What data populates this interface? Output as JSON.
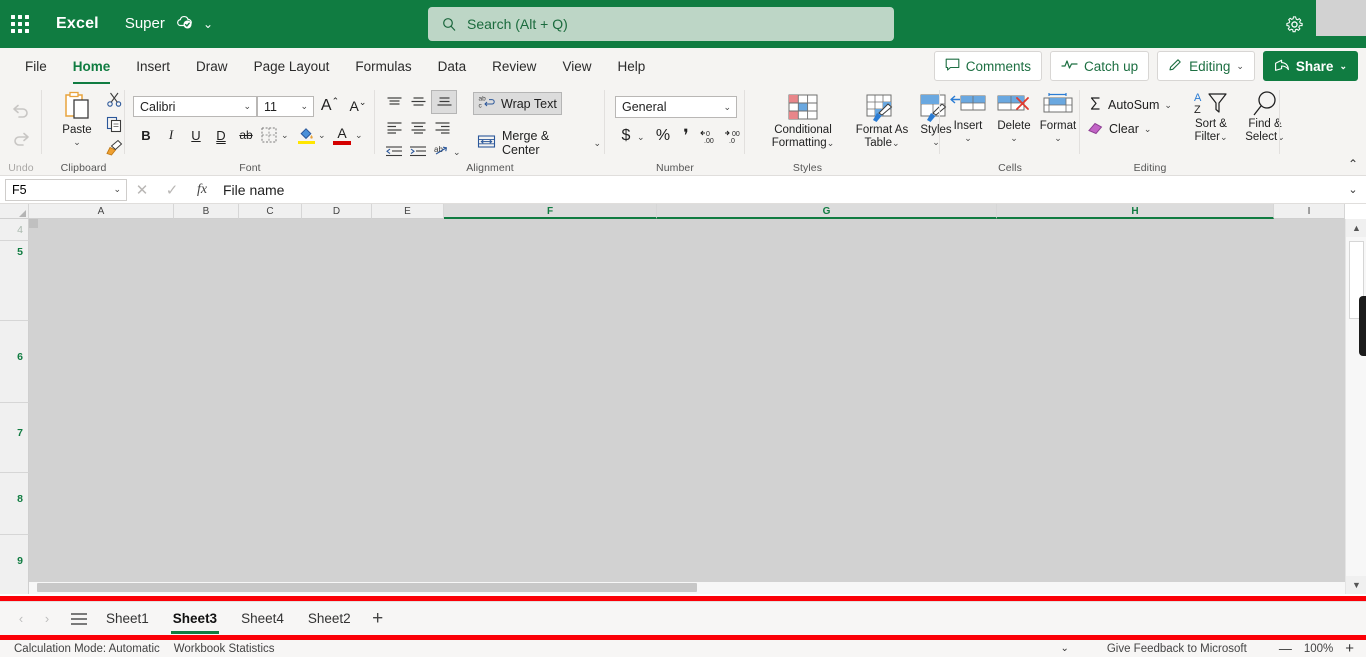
{
  "titlebar": {
    "app_launcher": "app-launcher",
    "brand": "Excel",
    "document_name": "Super",
    "autosave_status_icon": "cloud-check-icon",
    "doc_chevron": "⌄",
    "settings_icon": "gear-icon"
  },
  "search": {
    "placeholder": "Search (Alt + Q)",
    "value": "",
    "icon": "search-icon"
  },
  "ribbon_tabs": [
    {
      "label": "File",
      "active": false
    },
    {
      "label": "Home",
      "active": true
    },
    {
      "label": "Insert",
      "active": false
    },
    {
      "label": "Draw",
      "active": false
    },
    {
      "label": "Page Layout",
      "active": false
    },
    {
      "label": "Formulas",
      "active": false
    },
    {
      "label": "Data",
      "active": false
    },
    {
      "label": "Review",
      "active": false
    },
    {
      "label": "View",
      "active": false
    },
    {
      "label": "Help",
      "active": false
    }
  ],
  "top_actions": {
    "comments": "Comments",
    "catch_up": "Catch up",
    "editing": "Editing",
    "editing_chevron": "⌄",
    "share": "Share",
    "share_chevron": "⌄"
  },
  "ribbon": {
    "undo_group": {
      "label": "Undo",
      "undo": "undo-arrow-icon",
      "redo": "redo-arrow-icon"
    },
    "clipboard": {
      "label": "Clipboard",
      "paste": "Paste",
      "paste_chevron": "⌄",
      "cut_icon": "scissors-icon",
      "copy_icon": "copy-icon",
      "format_painter_icon": "format-painter-icon"
    },
    "font": {
      "label": "Font",
      "font_family": "Calibri",
      "font_size": "11",
      "grow_font": "A",
      "shrink_font": "A",
      "bold": "B",
      "italic": "I",
      "underline": "U",
      "double_underline": "D",
      "strikethrough": "ab",
      "borders_chevron": "⌄",
      "fill_color_chevron": "⌄",
      "font_color_chevron": "⌄",
      "font_color_letter": "A"
    },
    "alignment": {
      "label": "Alignment",
      "wrap_text": "Wrap Text",
      "merge_center": "Merge & Center",
      "merge_chevron": "⌄",
      "orientation_chevron": "⌄"
    },
    "number": {
      "label": "Number",
      "format": "General",
      "format_chevron": "⌄",
      "currency": "$",
      "currency_chevron": "⌄",
      "percent": "%",
      "comma": "❜",
      "increase_decimal": "increase-decimal-icon",
      "decrease_decimal": "decrease-decimal-icon"
    },
    "styles": {
      "label": "Styles",
      "conditional_formatting": "Conditional\nFormatting",
      "conditional_formatting_l1": "Conditional",
      "conditional_formatting_l2": "Formatting",
      "cf_chevron": "⌄",
      "format_as_table_l1": "Format As",
      "format_as_table_l2": "Table",
      "fat_chevron": "⌄",
      "styles_btn": "Styles",
      "styles_chevron": "⌄"
    },
    "cells": {
      "label": "Cells",
      "insert": "Insert",
      "insert_chevron": "⌄",
      "delete": "Delete",
      "delete_chevron": "⌄",
      "format": "Format",
      "format_chevron": "⌄"
    },
    "editing": {
      "label": "Editing",
      "autosum": "AutoSum",
      "autosum_chevron": "⌄",
      "clear": "Clear",
      "clear_chevron": "⌄",
      "sort_filter_l1": "Sort &",
      "sort_filter_l2": "Filter",
      "sort_filter_chevron": "⌄",
      "find_select_l1": "Find &",
      "find_select_l2": "Select",
      "find_select_chevron": "⌄"
    },
    "collapse_icon": "⌃"
  },
  "formula_bar": {
    "name_box": "F5",
    "name_box_chevron": "⌄",
    "cancel_icon": "✕",
    "enter_icon": "✓",
    "function_icon": "fx",
    "value": "File name",
    "expand_chevron": "⌄"
  },
  "grid": {
    "columns": [
      {
        "label": "A",
        "selected": false
      },
      {
        "label": "B",
        "selected": false
      },
      {
        "label": "C",
        "selected": false
      },
      {
        "label": "D",
        "selected": false
      },
      {
        "label": "E",
        "selected": false
      },
      {
        "label": "F",
        "selected": true
      },
      {
        "label": "G",
        "selected": true
      },
      {
        "label": "H",
        "selected": true
      },
      {
        "label": "I",
        "selected": false
      }
    ],
    "rows": [
      {
        "label": "4",
        "dim": true
      },
      {
        "label": "5",
        "dim": false
      },
      {
        "label": "6",
        "dim": false
      },
      {
        "label": "7",
        "dim": false
      },
      {
        "label": "8",
        "dim": false
      },
      {
        "label": "9",
        "dim": false
      }
    ],
    "select_all_icon": "select-all-corner-icon",
    "v_scroll_up": "▲",
    "v_scroll_down": "▼"
  },
  "sheet_bar": {
    "prev_icon": "‹",
    "next_icon": "›",
    "all_sheets_icon": "☰",
    "tabs": [
      {
        "label": "Sheet1",
        "active": false
      },
      {
        "label": "Sheet3",
        "active": true
      },
      {
        "label": "Sheet4",
        "active": false
      },
      {
        "label": "Sheet2",
        "active": false
      }
    ],
    "add_sheet": "+"
  },
  "status_bar": {
    "calculation_mode": "Calculation Mode: Automatic",
    "workbook_statistics": "Workbook Statistics",
    "overflow_chevron": "⌄",
    "feedback": "Give Feedback to Microsoft",
    "zoom_out": "—",
    "zoom_level": "100%",
    "zoom_in": "+"
  },
  "colors": {
    "brand_green": "#107c41",
    "ribbon_bg": "#f5f4f2",
    "highlight_red": "#fb0007",
    "overlay_gray": "#d2d2d2",
    "search_bg": "#bdd6c6"
  }
}
